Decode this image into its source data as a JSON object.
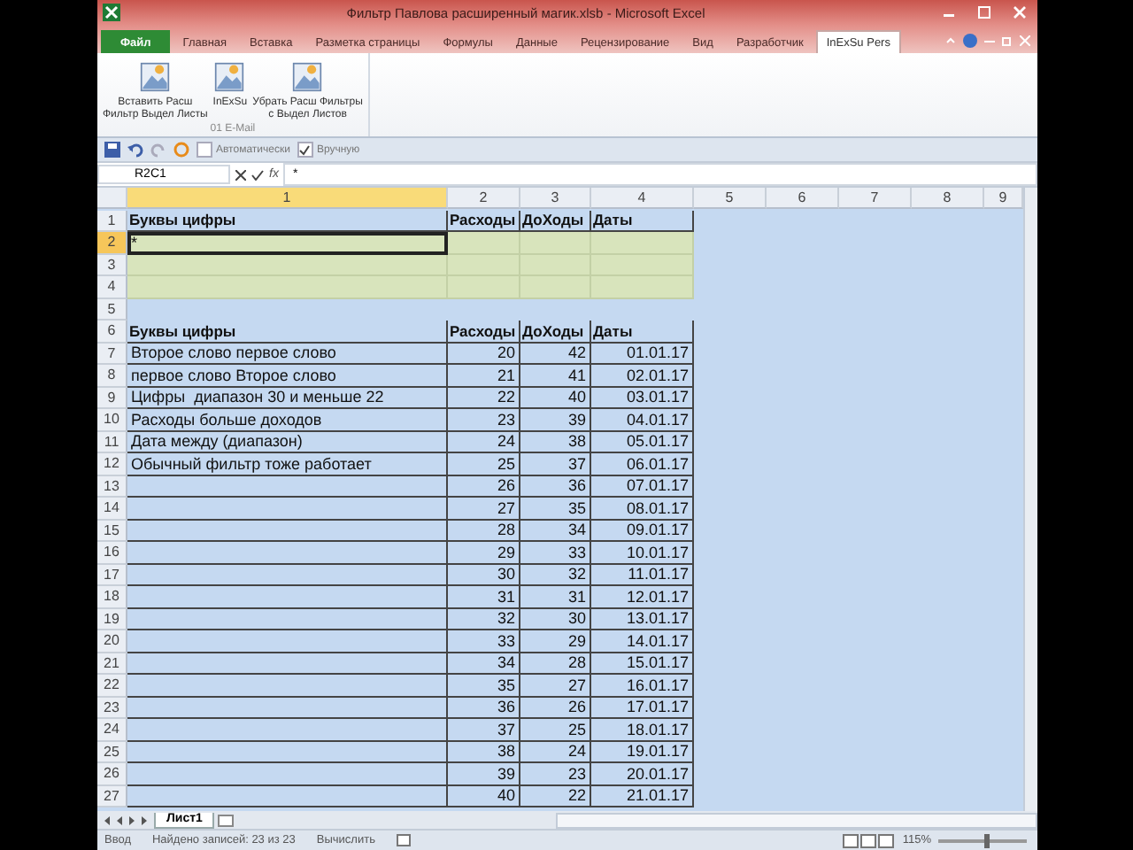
{
  "window": {
    "title": "Фильтр Павлова расширенный магик.xlsb - Microsoft Excel"
  },
  "tabs": [
    {
      "label": "Файл",
      "kind": "file",
      "selected": false
    },
    {
      "label": "Главная",
      "kind": "tab",
      "selected": false
    },
    {
      "label": "Вставка",
      "kind": "tab",
      "selected": false
    },
    {
      "label": "Разметка страницы",
      "kind": "tab",
      "selected": false
    },
    {
      "label": "Формулы",
      "kind": "tab",
      "selected": false
    },
    {
      "label": "Данные",
      "kind": "tab",
      "selected": false
    },
    {
      "label": "Рецензирование",
      "kind": "tab",
      "selected": false
    },
    {
      "label": "Вид",
      "kind": "tab",
      "selected": false
    },
    {
      "label": "Разработчик",
      "kind": "tab",
      "selected": false
    },
    {
      "label": "InExSu Pers",
      "kind": "tab",
      "selected": true
    }
  ],
  "ribbon": {
    "group_label": "01 E-Mail",
    "buttons": [
      {
        "lines": [
          "Вставить Расш",
          "Фильтр Выдел Листы"
        ]
      },
      {
        "lines": [
          "InExSu"
        ]
      },
      {
        "lines": [
          "Убрать Расш Фильтры",
          "с Выдел Листов"
        ]
      }
    ]
  },
  "quick_access": {
    "options": [
      {
        "label": "Автоматически",
        "checked": false
      },
      {
        "label": "Вручную",
        "checked": true
      }
    ]
  },
  "formula_bar": {
    "name_box": "R2C1",
    "function_button": "fx",
    "value": "*"
  },
  "sheet": {
    "columns": [
      {
        "label": "1",
        "selected": true
      },
      {
        "label": "2",
        "selected": false
      },
      {
        "label": "3",
        "selected": false
      },
      {
        "label": "4",
        "selected": false
      },
      {
        "label": "5",
        "selected": false
      },
      {
        "label": "6",
        "selected": false
      },
      {
        "label": "7",
        "selected": false
      },
      {
        "label": "8",
        "selected": false
      },
      {
        "label": "9",
        "selected": false
      }
    ],
    "rows": [
      {
        "num": "1",
        "kind": "header",
        "selected": false,
        "text": "Буквы цифры",
        "values": [
          "Расходы",
          "ДоХоды",
          "Даты"
        ]
      },
      {
        "num": "2",
        "kind": "criteria",
        "selected": true,
        "text": "*"
      },
      {
        "num": "3",
        "kind": "criteria",
        "selected": false
      },
      {
        "num": "4",
        "kind": "criteria",
        "selected": false
      },
      {
        "num": "5",
        "kind": "blank",
        "selected": false
      },
      {
        "num": "6",
        "kind": "header",
        "selected": false,
        "text": "Буквы цифры",
        "values": [
          "Расходы",
          "ДоХоды",
          "Даты"
        ]
      },
      {
        "num": "7",
        "kind": "data",
        "selected": false,
        "text": "Второе слово первое слово",
        "values": [
          "20",
          "42",
          "01.01.17"
        ]
      },
      {
        "num": "8",
        "kind": "data",
        "selected": false,
        "text": "первое слово Второе слово",
        "values": [
          "21",
          "41",
          "02.01.17"
        ]
      },
      {
        "num": "9",
        "kind": "data",
        "selected": false,
        "text": "Цифры  диапазон 30 и меньше 22",
        "values": [
          "22",
          "40",
          "03.01.17"
        ]
      },
      {
        "num": "10",
        "kind": "data",
        "selected": false,
        "text": "Расходы больше доходов",
        "values": [
          "23",
          "39",
          "04.01.17"
        ]
      },
      {
        "num": "11",
        "kind": "data",
        "selected": false,
        "text": "Дата между (диапазон)",
        "values": [
          "24",
          "38",
          "05.01.17"
        ]
      },
      {
        "num": "12",
        "kind": "data",
        "selected": false,
        "text": "Обычный фильтр тоже работает",
        "values": [
          "25",
          "37",
          "06.01.17"
        ]
      },
      {
        "num": "13",
        "kind": "data",
        "selected": false,
        "values": [
          "26",
          "36",
          "07.01.17"
        ]
      },
      {
        "num": "14",
        "kind": "data",
        "selected": false,
        "values": [
          "27",
          "35",
          "08.01.17"
        ]
      },
      {
        "num": "15",
        "kind": "data",
        "selected": false,
        "values": [
          "28",
          "34",
          "09.01.17"
        ]
      },
      {
        "num": "16",
        "kind": "data",
        "selected": false,
        "values": [
          "29",
          "33",
          "10.01.17"
        ]
      },
      {
        "num": "17",
        "kind": "data",
        "selected": false,
        "values": [
          "30",
          "32",
          "11.01.17"
        ]
      },
      {
        "num": "18",
        "kind": "data",
        "selected": false,
        "values": [
          "31",
          "31",
          "12.01.17"
        ]
      },
      {
        "num": "19",
        "kind": "data",
        "selected": false,
        "values": [
          "32",
          "30",
          "13.01.17"
        ]
      },
      {
        "num": "20",
        "kind": "data",
        "selected": false,
        "values": [
          "33",
          "29",
          "14.01.17"
        ]
      },
      {
        "num": "21",
        "kind": "data",
        "selected": false,
        "values": [
          "34",
          "28",
          "15.01.17"
        ]
      },
      {
        "num": "22",
        "kind": "data",
        "selected": false,
        "values": [
          "35",
          "27",
          "16.01.17"
        ]
      },
      {
        "num": "23",
        "kind": "data",
        "selected": false,
        "values": [
          "36",
          "26",
          "17.01.17"
        ]
      },
      {
        "num": "24",
        "kind": "data",
        "selected": false,
        "values": [
          "37",
          "25",
          "18.01.17"
        ]
      },
      {
        "num": "25",
        "kind": "data",
        "selected": false,
        "values": [
          "38",
          "24",
          "19.01.17"
        ]
      },
      {
        "num": "26",
        "kind": "data",
        "selected": false,
        "values": [
          "39",
          "23",
          "20.01.17"
        ]
      },
      {
        "num": "27",
        "kind": "data",
        "selected": false,
        "values": [
          "40",
          "22",
          "21.01.17"
        ]
      }
    ]
  },
  "sheet_tabs": [
    {
      "label": "Лист1",
      "selected": true
    }
  ],
  "status_bar": {
    "mode": "Ввод",
    "records": "Найдено записей: 23 из 23",
    "calculate": "Вычислить",
    "zoom": {
      "label": "115%",
      "level": 0.55
    }
  }
}
